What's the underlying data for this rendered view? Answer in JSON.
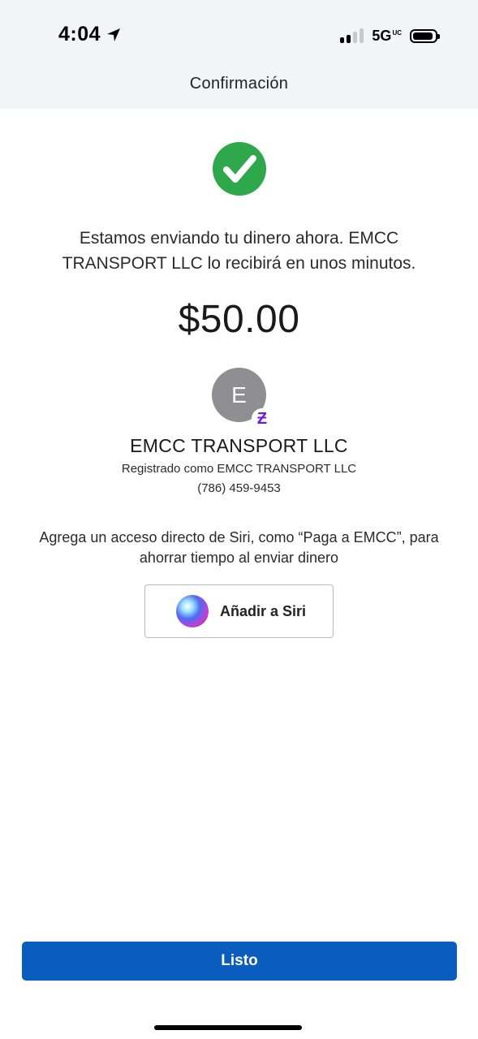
{
  "status_bar": {
    "time": "4:04",
    "network": "5G",
    "network_badge": "UC",
    "icons": [
      "location-arrow-icon",
      "signal-bars-icon",
      "battery-icon"
    ]
  },
  "header": {
    "title": "Confirmación"
  },
  "confirmation": {
    "icon": "checkmark-circle-icon",
    "icon_color": "#2ea84a",
    "message": "Estamos enviando tu dinero ahora. EMCC TRANSPORT LLC lo recibirá en unos minutos.",
    "amount": "$50.00"
  },
  "recipient": {
    "avatar_initial": "E",
    "badge_glyph": "Ƶ",
    "badge_color": "#6d1ed4",
    "name": "EMCC TRANSPORT LLC",
    "registered_as": "Registrado como EMCC TRANSPORT LLC",
    "phone": "(786) 459-9453"
  },
  "siri": {
    "prompt": "Agrega un acceso directo de Siri, como “Paga a EMCC”, para ahorrar tiempo al enviar dinero",
    "button_label": "Añadir a Siri",
    "icon": "siri-orb-icon"
  },
  "footer": {
    "done_label": "Listo",
    "done_color": "#0a5dbf"
  }
}
